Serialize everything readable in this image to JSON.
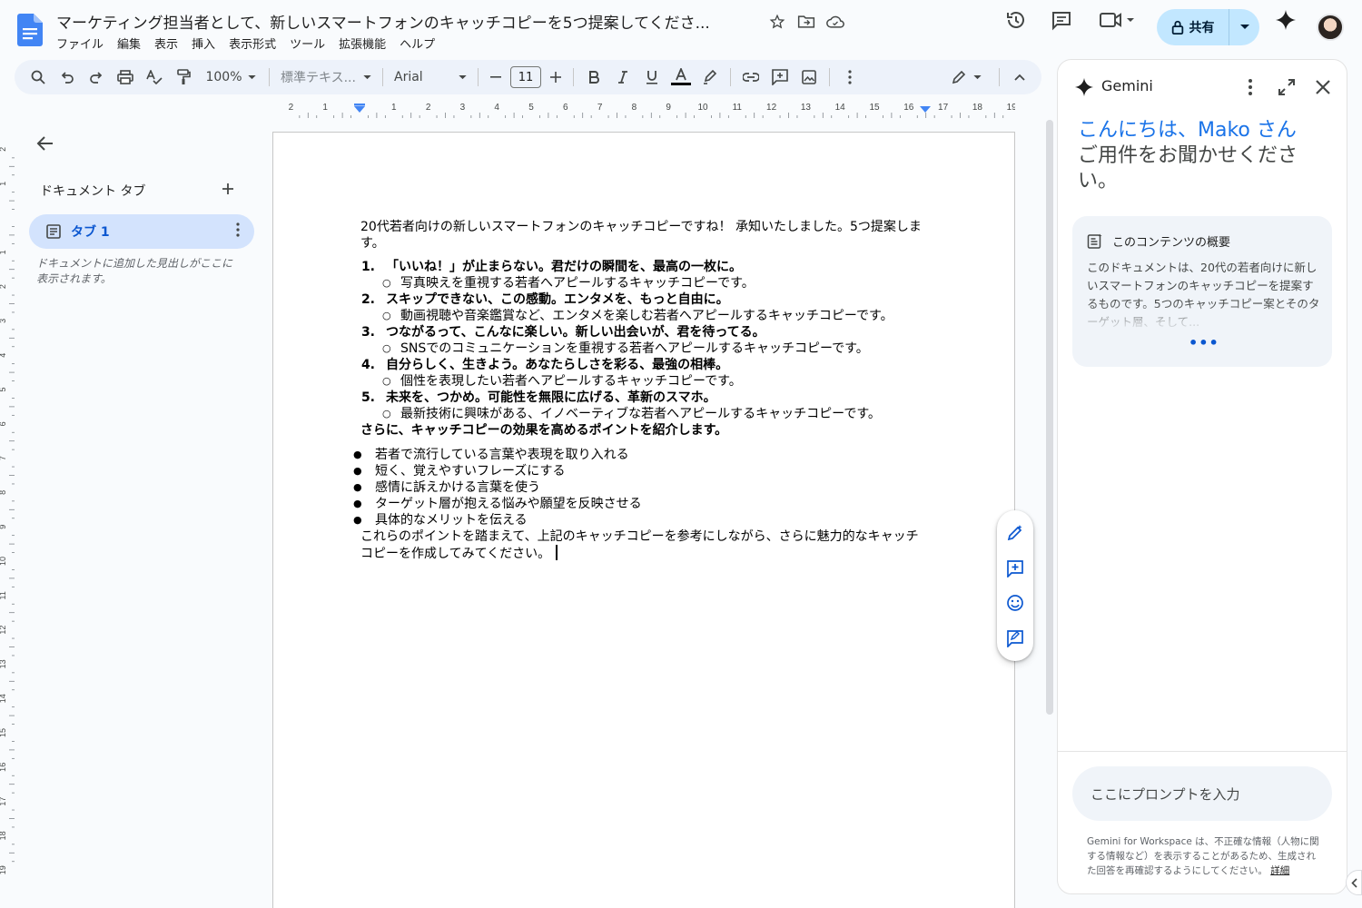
{
  "app": {
    "doc_title": "マーケティング担当者として、新しいスマートフォンのキャッチコピーを5つ提案してくださ...",
    "menu": [
      "ファイル",
      "編集",
      "表示",
      "挿入",
      "表示形式",
      "ツール",
      "拡張機能",
      "ヘルプ"
    ],
    "share_label": "共有"
  },
  "toolbar": {
    "zoom": "100%",
    "style": "標準テキス...",
    "font": "Arial",
    "font_size": "11"
  },
  "ruler": {
    "h_labels": [
      "2",
      "1",
      "1",
      "2",
      "3",
      "4",
      "5",
      "6",
      "7",
      "8",
      "9",
      "10",
      "11",
      "12",
      "13",
      "14",
      "15",
      "16",
      "17",
      "18",
      "19"
    ],
    "v_labels": [
      "2",
      "1",
      "1",
      "2",
      "3",
      "4",
      "5",
      "6",
      "7",
      "8",
      "9",
      "10",
      "11",
      "12",
      "13",
      "14",
      "15",
      "16",
      "17",
      "18",
      "19"
    ]
  },
  "left_panel": {
    "heading": "ドキュメント タブ",
    "tab_label": "タブ 1",
    "hint": "ドキュメントに追加した見出しがここに表示されます。"
  },
  "document": {
    "intro": "20代若者向けの新しいスマートフォンのキャッチコピーですね！ 承知いたしました。5つ提案します。",
    "copies": [
      {
        "num": "1.",
        "title": "「いいね！」が止まらない。君だけの瞬間を、最高の一枚に。",
        "desc": "写真映えを重視する若者へアピールするキャッチコピーです。"
      },
      {
        "num": "2.",
        "title": "スキップできない、この感動。エンタメを、もっと自由に。",
        "desc": "動画視聴や音楽鑑賞など、エンタメを楽しむ若者へアピールするキャッチコピーです。"
      },
      {
        "num": "3.",
        "title": "つながるって、こんなに楽しい。新しい出会いが、君を待ってる。",
        "desc": "SNSでのコミュニケーションを重視する若者へアピールするキャッチコピーです。"
      },
      {
        "num": "4.",
        "title": "自分らしく、生きよう。あなたらしさを彩る、最強の相棒。",
        "desc": "個性を表現したい若者へアピールするキャッチコピーです。"
      },
      {
        "num": "5.",
        "title": "未来を、つかめ。可能性を無限に広げる、革新のスマホ。",
        "desc": "最新技術に興味がある、イノベーティブな若者へアピールするキャッチコピーです。"
      }
    ],
    "points_heading": "さらに、キャッチコピーの効果を高めるポイントを紹介します。",
    "points": [
      "若者で流行している言葉や表現を取り入れる",
      "短く、覚えやすいフレーズにする",
      "感情に訴えかける言葉を使う",
      "ターゲット層が抱える悩みや願望を反映させる",
      "具体的なメリットを伝える"
    ],
    "closing": "これらのポイントを踏まえて、上記のキャッチコピーを参考にしながら、さらに魅力的なキャッチコピーを作成してみてください。"
  },
  "gemini": {
    "title": "Gemini",
    "greeting_line1": "こんにちは、Mako さん",
    "greeting_line2": "ご用件をお聞かせください。",
    "card_title": "このコンテンツの概要",
    "card_body": "このドキュメントは、20代の若者向けに新しいスマートフォンのキャッチコピーを提案するものです。5つのキャッチコピー案とそのターゲット層、そして...",
    "card_more": "•••",
    "input_placeholder": "ここにプロンプトを入力",
    "disclaimer": "Gemini for Workspace は、不正確な情報（人物に関する情報など）を表示することがあるため、生成された回答を再確認するようにしてください。",
    "disclaimer_link": "詳細"
  },
  "colors": {
    "accent": "#0b57d0",
    "share_bg": "#c2e7ff",
    "tab_bg": "#d3e3fd",
    "toolbar_bg": "#edf2fa",
    "greeting_blue": "#1a73e8"
  }
}
